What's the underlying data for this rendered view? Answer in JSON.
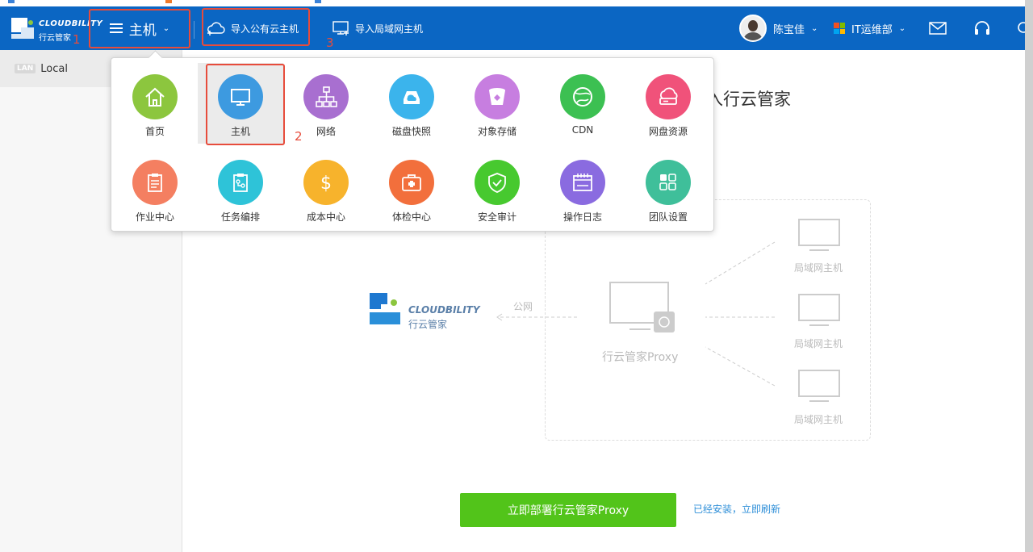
{
  "header": {
    "logo": {
      "brand": "CLOUDBILITY",
      "cn": "行云管家"
    },
    "menu_label": "主机",
    "links": [
      {
        "label": "导入公有云主机",
        "icon": "cloud-add-icon"
      },
      {
        "label": "导入局域网主机",
        "icon": "monitor-add-icon"
      }
    ],
    "user_name": "陈宝佳",
    "team_name": "IT运维部",
    "annotations": [
      "1",
      "2",
      "3"
    ]
  },
  "sidebar": {
    "items": [
      {
        "tag": "LAN",
        "label": "Local"
      }
    ]
  },
  "main": {
    "title_fragment": "入行云管家",
    "diagram": {
      "brand": "CLOUDBILITY",
      "brand_cn": "行云管家",
      "public_net": "公网",
      "proxy_label": "行云管家Proxy",
      "lan_hosts": [
        "局域网主机",
        "局域网主机",
        "局域网主机"
      ]
    },
    "deploy_button": "立即部署行云管家Proxy",
    "refresh_link": "已经安装，立即刷新"
  },
  "dropdown": {
    "items": [
      {
        "label": "首页",
        "color": "#8cc63e",
        "icon": "home-icon"
      },
      {
        "label": "主机",
        "color": "#3d9ae0",
        "icon": "monitor-icon",
        "active": true
      },
      {
        "label": "网络",
        "color": "#a86fd0",
        "icon": "network-icon"
      },
      {
        "label": "磁盘快照",
        "color": "#3bb4ec",
        "icon": "disk-icon"
      },
      {
        "label": "对象存储",
        "color": "#c77ee0",
        "icon": "bucket-icon"
      },
      {
        "label": "CDN",
        "color": "#3cc052",
        "icon": "globe-icon"
      },
      {
        "label": "网盘资源",
        "color": "#f0527a",
        "icon": "cloud-drive-icon"
      },
      {
        "label": "作业中心",
        "color": "#f47f61",
        "icon": "clipboard-icon"
      },
      {
        "label": "任务编排",
        "color": "#2ec3d8",
        "icon": "flow-icon"
      },
      {
        "label": "成本中心",
        "color": "#f7b32c",
        "icon": "dollar-icon"
      },
      {
        "label": "体检中心",
        "color": "#f26f3c",
        "icon": "medkit-icon"
      },
      {
        "label": "安全审计",
        "color": "#47c92f",
        "icon": "shield-icon"
      },
      {
        "label": "操作日志",
        "color": "#8a6be0",
        "icon": "calendar-icon"
      },
      {
        "label": "团队设置",
        "color": "#3fbf9a",
        "icon": "grid-icon"
      }
    ]
  },
  "colors": {
    "header_bg": "#0b66c3",
    "annotation_red": "#e74c3c",
    "deploy_green": "#52c41a",
    "link_blue": "#2f8fd8"
  }
}
